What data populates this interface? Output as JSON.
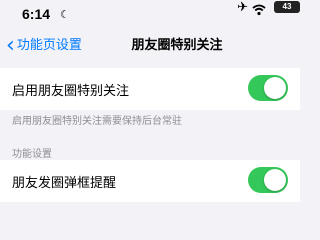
{
  "status_bar": {
    "time": "6:14",
    "moon": "☾",
    "airplane": "✈",
    "battery": "43"
  },
  "nav": {
    "back_chevron": "‹",
    "back_label": "功能页设置",
    "title": "朋友圈特别关注"
  },
  "rows": [
    {
      "label": "启用朋友圈特别关注",
      "toggle_on": true
    },
    {
      "label": "朋友发圈弹框提醒",
      "toggle_on": true
    }
  ],
  "footnote": "启用朋友圈特别关注需要保持后台常驻",
  "section_header": "功能设置",
  "colors": {
    "accent": "#007aff",
    "toggle_on": "#34c759",
    "background": "#f2f2f7"
  }
}
